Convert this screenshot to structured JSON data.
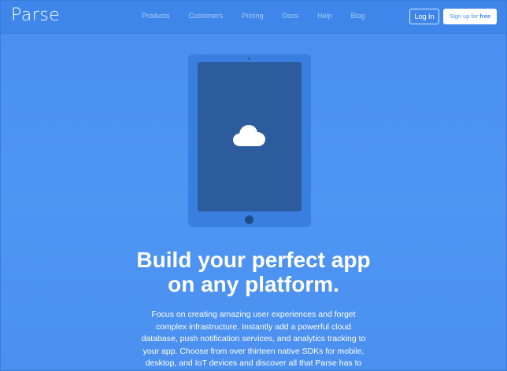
{
  "brand": {
    "name": "Parse"
  },
  "nav": {
    "links": [
      "Products",
      "Customers",
      "Pricing",
      "Docs",
      "Help",
      "Blog"
    ],
    "login_label": "Log In",
    "signup_prefix": "Sign up for ",
    "signup_emphasis": "free"
  },
  "hero": {
    "illustration_icon": "cloud-icon",
    "headline_line1": "Build your perfect app",
    "headline_line2": "on any platform.",
    "description": "Focus on creating amazing user experiences and forget complex infrastructure. Instantly add a powerful cloud database, push notification services, and analytics tracking to your app. Choose from over thirteen native SDKs for mobile, desktop, and IoT devices and discover all that Parse has to offer."
  },
  "colors": {
    "background": "#4d92f0",
    "navbar": "#3f86ea",
    "tablet_body": "#3a7fe0",
    "tablet_screen": "#2c5c9d",
    "text": "#ffffff",
    "nav_link": "#a9cbf7"
  }
}
